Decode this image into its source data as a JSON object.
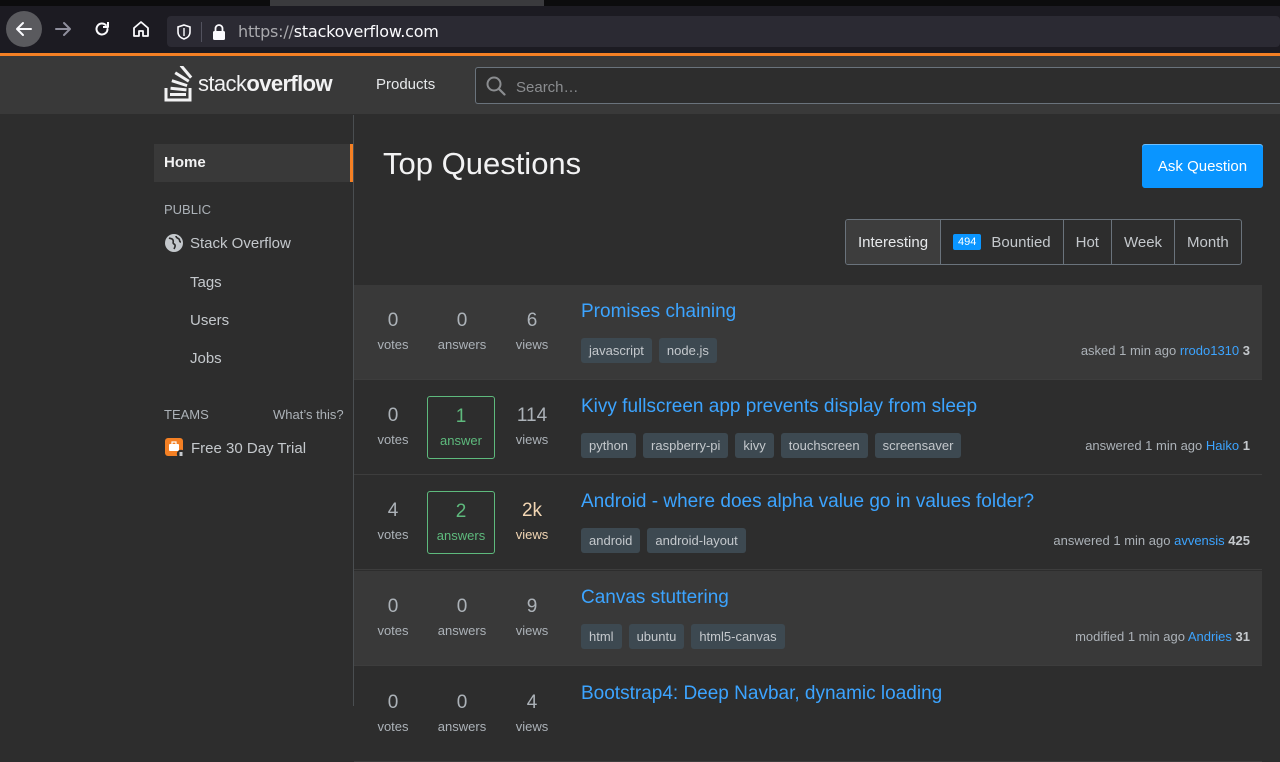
{
  "browser": {
    "url_protocol": "https://",
    "url_host": "stackoverflow.com"
  },
  "header": {
    "logo_light": "stack",
    "logo_bold": "overflow",
    "products": "Products",
    "search_placeholder": "Search…"
  },
  "sidebar": {
    "home": "Home",
    "public_label": "PUBLIC",
    "stack_overflow": "Stack Overflow",
    "items": [
      "Tags",
      "Users",
      "Jobs"
    ],
    "teams_label": "TEAMS",
    "whats_this": "What’s this?",
    "free_trial": "Free 30 Day Trial"
  },
  "main": {
    "title": "Top Questions",
    "ask_button": "Ask Question",
    "filters": {
      "interesting": "Interesting",
      "bountied_count": "494",
      "bountied": "Bountied",
      "hot": "Hot",
      "week": "Week",
      "month": "Month"
    },
    "questions": [
      {
        "votes": "0",
        "votes_label": "votes",
        "answers": "0",
        "answers_label": "answers",
        "views": "6",
        "views_label": "views",
        "title": "Promises chaining",
        "tags": [
          "javascript",
          "node.js"
        ],
        "action": "asked 1 min ago",
        "user": "rrodo1310",
        "rep": "3"
      },
      {
        "votes": "0",
        "votes_label": "votes",
        "answers": "1",
        "answers_label": "answer",
        "views": "114",
        "views_label": "views",
        "title": "Kivy fullscreen app prevents display from sleep",
        "tags": [
          "python",
          "raspberry-pi",
          "kivy",
          "touchscreen",
          "screensaver"
        ],
        "action": "answered 1 min ago",
        "user": "Haiko",
        "rep": "1"
      },
      {
        "votes": "4",
        "votes_label": "votes",
        "answers": "2",
        "answers_label": "answers",
        "views": "2k",
        "views_label": "views",
        "title": "Android - where does alpha value go in values folder?",
        "tags": [
          "android",
          "android-layout"
        ],
        "action": "answered 1 min ago",
        "user": "avvensis",
        "rep": "425"
      },
      {
        "votes": "0",
        "votes_label": "votes",
        "answers": "0",
        "answers_label": "answers",
        "views": "9",
        "views_label": "views",
        "title": "Canvas stuttering",
        "tags": [
          "html",
          "ubuntu",
          "html5-canvas"
        ],
        "action": "modified 1 min ago",
        "user": "Andries",
        "rep": "31"
      },
      {
        "votes": "0",
        "votes_label": "votes",
        "answers": "0",
        "answers_label": "answers",
        "views": "4",
        "views_label": "views",
        "title": "Bootstrap4: Deep Navbar, dynamic loading",
        "tags": [],
        "action": "",
        "user": "",
        "rep": ""
      }
    ]
  }
}
